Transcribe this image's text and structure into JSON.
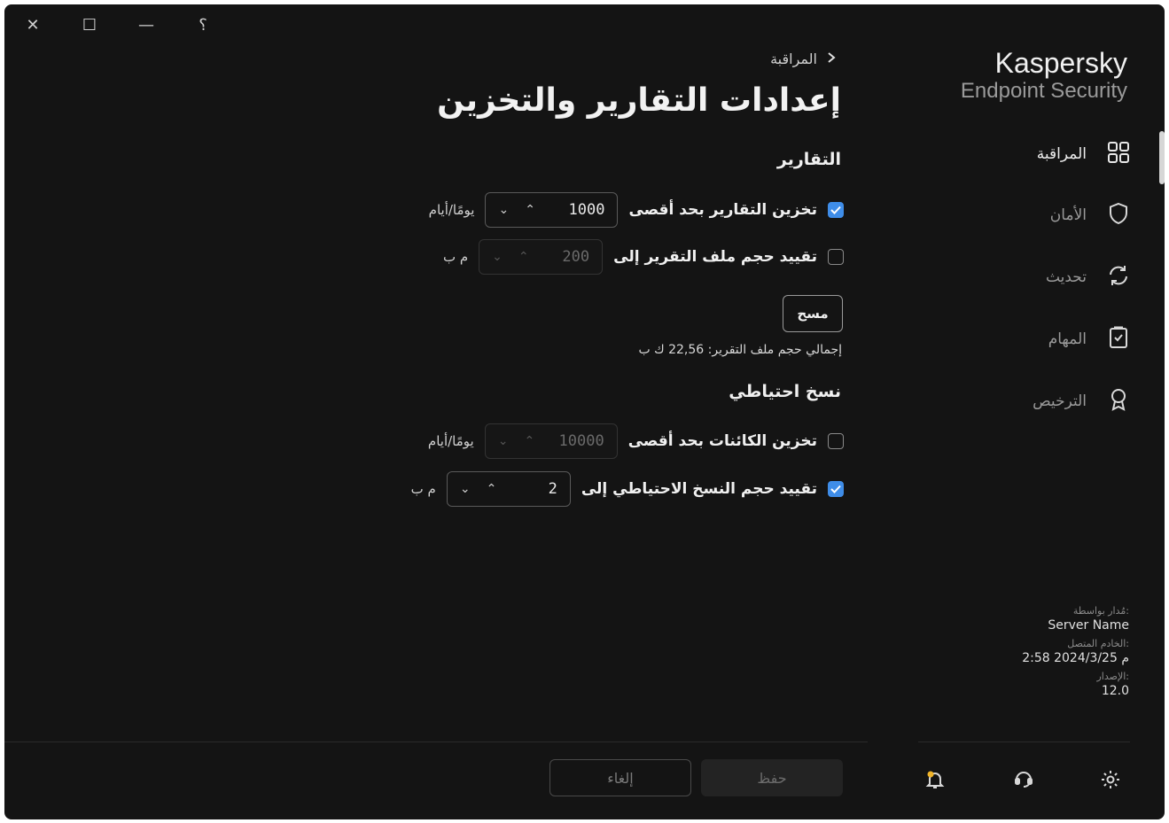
{
  "app": {
    "brand": "Kaspersky",
    "product": "Endpoint Security"
  },
  "titlebar": {
    "close": "✕",
    "maximize": "☐",
    "minimize": "—",
    "help": "؟"
  },
  "nav": {
    "items": [
      {
        "label": "المراقبة",
        "icon": "monitoring-grid-icon",
        "active": true
      },
      {
        "label": "الأمان",
        "icon": "shield-icon",
        "active": false
      },
      {
        "label": "تحديث",
        "icon": "refresh-icon",
        "active": false
      },
      {
        "label": "المهام",
        "icon": "clipboard-check-icon",
        "active": false
      },
      {
        "label": "الترخيص",
        "icon": "award-icon",
        "active": false
      }
    ]
  },
  "breadcrumb": {
    "label": "المراقبة",
    "icon": "chevron-right-icon"
  },
  "page": {
    "title": "إعدادات التقارير والتخزين"
  },
  "reports": {
    "heading": "التقارير",
    "store_reports": {
      "label": "تخزين التقارير بحد أقصى",
      "checked": true,
      "value": "1000",
      "unit": "يومًا/أيام"
    },
    "limit_file": {
      "label": "تقييد حجم ملف التقرير إلى",
      "checked": false,
      "value": "200",
      "unit": "م ب"
    },
    "clear_label": "مسح",
    "total_size": "إجمالي حجم ملف التقرير: 22,56 ك ب"
  },
  "backup": {
    "heading": "نسخ احتياطي",
    "store_objects": {
      "label": "تخزين الكائنات بحد أقصى",
      "checked": false,
      "value": "10000",
      "unit": "يومًا/أيام"
    },
    "limit_backup": {
      "label": "تقييد حجم النسخ الاحتياطي إلى",
      "checked": true,
      "value": "2",
      "unit": "م ب"
    }
  },
  "info": {
    "managed_by_label": "مُدار بواسطة:",
    "managed_by_value": "Server Name",
    "server_label": "الخادم المتصل:",
    "server_value": "2:58 2024/3/25 م",
    "version_label": "الإصدار:",
    "version_value": "12.0"
  },
  "footer": {
    "save_label": "حفظ",
    "cancel_label": "إلغاء"
  },
  "sidebar_footer_icons": [
    "notifications-bell-icon",
    "support-icon",
    "settings-gear-icon"
  ],
  "colors": {
    "accent": "#3f8de8",
    "background": "#141414",
    "notification_dot": "#f0b429"
  }
}
